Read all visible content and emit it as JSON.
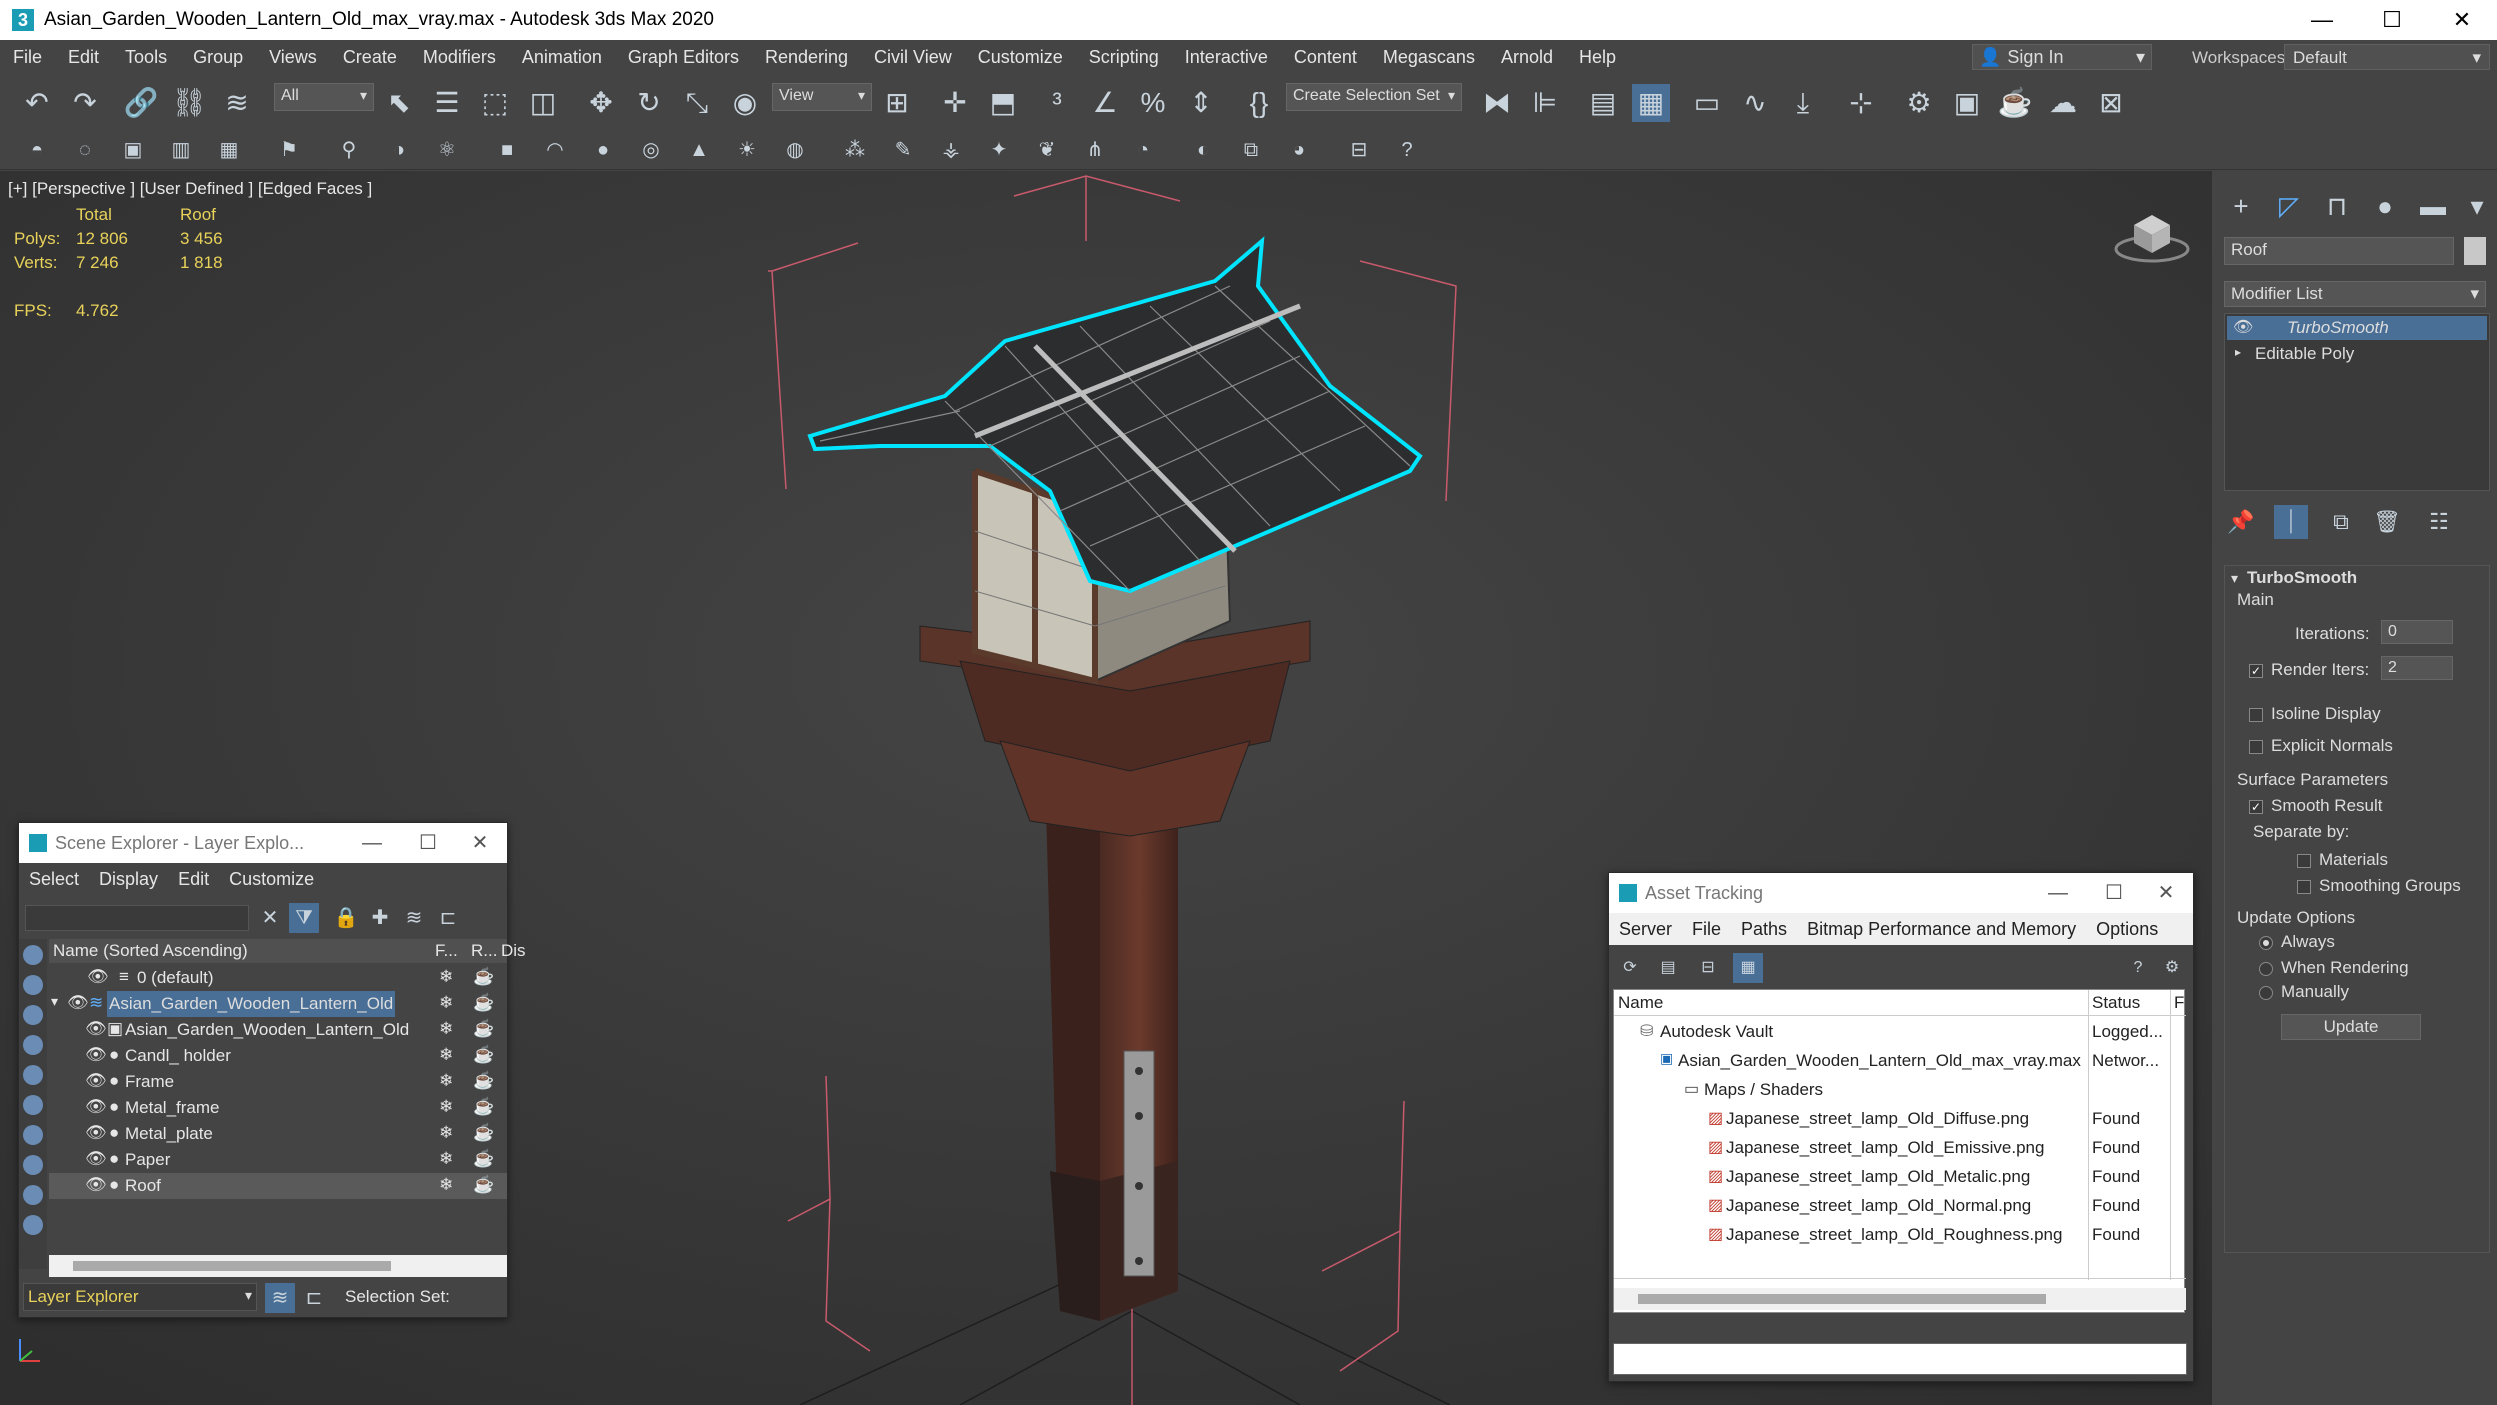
{
  "app": {
    "title": "Asian_Garden_Wooden_Lantern_Old_max_vray.max - Autodesk 3ds Max 2020",
    "icon_letter": "3",
    "window_buttons": [
      "—",
      "☐",
      "✕"
    ]
  },
  "menu": [
    "File",
    "Edit",
    "Tools",
    "Group",
    "Views",
    "Create",
    "Modifiers",
    "Animation",
    "Graph Editors",
    "Rendering",
    "Civil View",
    "Customize",
    "Scripting",
    "Interactive",
    "Content",
    "Megascans",
    "Arnold",
    "Help"
  ],
  "signin": {
    "label": "Sign In",
    "icon": "user-icon"
  },
  "workspaces": {
    "label": "Workspaces:",
    "value": "Default"
  },
  "toolbar": {
    "filter_value": "All",
    "refcoord_value": "View",
    "selection_set_placeholder": "Create Selection Set"
  },
  "viewport": {
    "label": "[+] [Perspective ] [User Defined ] [Edged Faces ]",
    "stats": {
      "header_total": "Total",
      "header_obj": "Roof",
      "polys_label": "Polys:",
      "polys_total": "12 806",
      "polys_obj": "3 456",
      "verts_label": "Verts:",
      "verts_total": "7 246",
      "verts_obj": "1 818",
      "fps_label": "FPS:",
      "fps_value": "4.762"
    }
  },
  "command_panel": {
    "object_name": "Roof",
    "object_color": "#c8c8c8",
    "modifier_list_label": "Modifier List",
    "stack": [
      "TurboSmooth",
      "Editable Poly"
    ],
    "rollout_title": "TurboSmooth",
    "main_label": "Main",
    "iterations_label": "Iterations:",
    "iterations_value": "0",
    "render_iters_label": "Render Iters:",
    "render_iters_value": "2",
    "isoline_label": "Isoline Display",
    "explicit_normals_label": "Explicit Normals",
    "surface_params_label": "Surface Parameters",
    "smooth_result_label": "Smooth Result",
    "separate_by_label": "Separate by:",
    "materials_label": "Materials",
    "smoothing_groups_label": "Smoothing Groups",
    "update_options_label": "Update Options",
    "always_label": "Always",
    "when_rendering_label": "When Rendering",
    "manually_label": "Manually",
    "update_button": "Update"
  },
  "scene_explorer": {
    "title": "Scene Explorer - Layer Explo...",
    "menu": [
      "Select",
      "Display",
      "Edit",
      "Customize"
    ],
    "col_name": "Name (Sorted Ascending)",
    "col_f": "F...",
    "col_r": "R...",
    "col_dis": "Dis",
    "rows": [
      {
        "label": "0 (default)",
        "indent": 0
      },
      {
        "label": "Asian_Garden_Wooden_Lantern_Old",
        "indent": 0
      },
      {
        "label": "Asian_Garden_Wooden_Lantern_Old",
        "indent": 1
      },
      {
        "label": "Candl_ holder",
        "indent": 1
      },
      {
        "label": "Frame",
        "indent": 1
      },
      {
        "label": "Metal_frame",
        "indent": 1
      },
      {
        "label": "Metal_plate",
        "indent": 1
      },
      {
        "label": "Paper",
        "indent": 1
      },
      {
        "label": "Roof",
        "indent": 1
      }
    ],
    "footer_dropdown": "Layer Explorer",
    "selection_set_label": "Selection Set:"
  },
  "asset_tracking": {
    "title": "Asset Tracking",
    "menu": [
      "Server",
      "File",
      "Paths",
      "Bitmap Performance and Memory",
      "Options"
    ],
    "col_name": "Name",
    "col_status": "Status",
    "col_extra": "F",
    "rows": [
      {
        "name": "Autodesk Vault",
        "status": "Logged...",
        "icon": "vault-icon",
        "level": 0
      },
      {
        "name": "Asian_Garden_Wooden_Lantern_Old_max_vray.max",
        "status": "Networ...",
        "icon": "max-file-icon",
        "level": 1
      },
      {
        "name": "Maps / Shaders",
        "status": "",
        "icon": "folder-icon",
        "level": 2
      },
      {
        "name": "Japanese_street_lamp_Old_Diffuse.png",
        "status": "Found",
        "icon": "image-file-icon",
        "level": 3
      },
      {
        "name": "Japanese_street_lamp_Old_Emissive.png",
        "status": "Found",
        "icon": "image-file-icon",
        "level": 3
      },
      {
        "name": "Japanese_street_lamp_Old_Metalic.png",
        "status": "Found",
        "icon": "image-file-icon",
        "level": 3
      },
      {
        "name": "Japanese_street_lamp_Old_Normal.png",
        "status": "Found",
        "icon": "image-file-icon",
        "level": 3
      },
      {
        "name": "Japanese_street_lamp_Old_Roughness.png",
        "status": "Found",
        "icon": "image-file-icon",
        "level": 3
      }
    ]
  },
  "colors": {
    "accent": "#4a6f96",
    "selection_highlight": "#00e5ff",
    "stat_yellow": "#e8d25a",
    "bounding_box": "#d06070"
  }
}
